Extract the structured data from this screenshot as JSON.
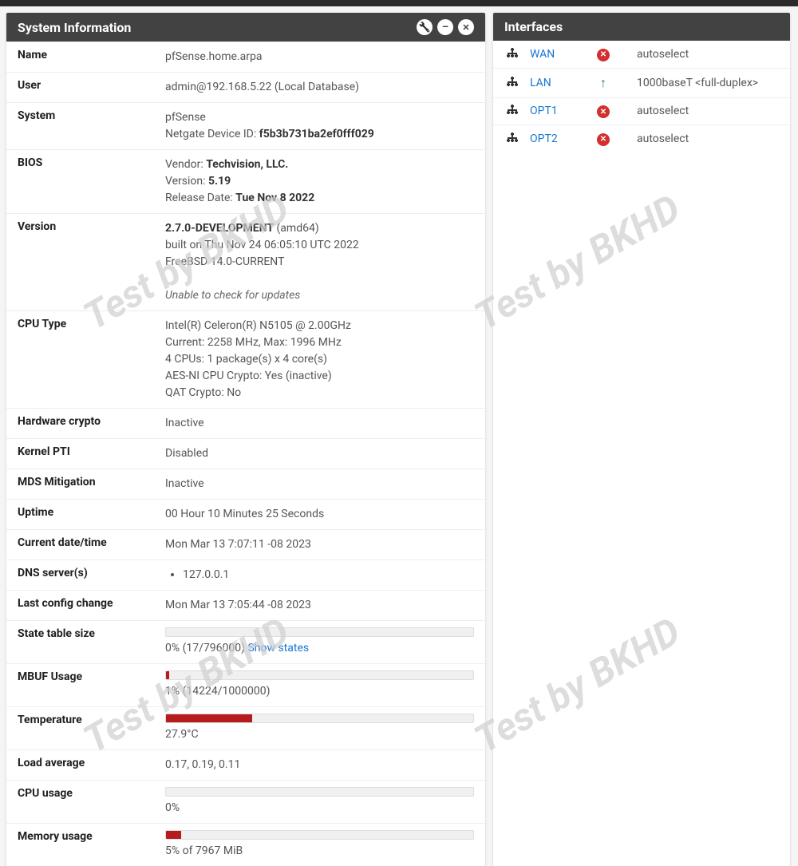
{
  "watermark_text": "Test by BKHD",
  "sysinfo": {
    "title": "System Information",
    "rows": {
      "name_label": "Name",
      "name_value": "pfSense.home.arpa",
      "user_label": "User",
      "user_value": "admin@192.168.5.22 (Local Database)",
      "system_label": "System",
      "system_line1": "pfSense",
      "system_line2_prefix": "Netgate Device ID: ",
      "system_line2_bold": "f5b3b731ba2ef0fff029",
      "bios_label": "BIOS",
      "bios_l1_prefix": "Vendor: ",
      "bios_l1_bold": "Techvision, LLC.",
      "bios_l2_prefix": "Version: ",
      "bios_l2_bold": "5.19",
      "bios_l3_prefix": "Release Date: ",
      "bios_l3_bold": "Tue Nov 8 2022",
      "version_label": "Version",
      "version_l1_bold": "2.7.0-DEVELOPMENT",
      "version_l1_rest": " (amd64)",
      "version_l2": "built on Thu Nov 24 06:05:10 UTC 2022",
      "version_l3": "FreeBSD 14.0-CURRENT",
      "version_update": "Unable to check for updates",
      "cpu_label": "CPU Type",
      "cpu_l1": "Intel(R) Celeron(R) N5105 @ 2.00GHz",
      "cpu_l2": "Current: 2258 MHz, Max: 1996 MHz",
      "cpu_l3": "4 CPUs: 1 package(s) x 4 core(s)",
      "cpu_l4": "AES-NI CPU Crypto: Yes (inactive)",
      "cpu_l5": "QAT Crypto: No",
      "hwcrypto_label": "Hardware crypto",
      "hwcrypto_value": "Inactive",
      "pti_label": "Kernel PTI",
      "pti_value": "Disabled",
      "mds_label": "MDS Mitigation",
      "mds_value": "Inactive",
      "uptime_label": "Uptime",
      "uptime_value": "00 Hour 10 Minutes 25 Seconds",
      "datetime_label": "Current date/time",
      "datetime_value": "Mon Mar 13 7:07:11 -08 2023",
      "dns_label": "DNS server(s)",
      "dns_value": "127.0.0.1",
      "lastcfg_label": "Last config change",
      "lastcfg_value": "Mon Mar 13 7:05:44 -08 2023",
      "state_label": "State table size",
      "state_text": "0% (17/796000) ",
      "state_link": "Show states",
      "mbuf_label": "MBUF Usage",
      "mbuf_text": "1% (14224/1000000)",
      "temp_label": "Temperature",
      "temp_text": "27.9°C",
      "load_label": "Load average",
      "load_value": "0.17, 0.19, 0.11",
      "cpuusage_label": "CPU usage",
      "cpuusage_text": "0%",
      "mem_label": "Memory usage",
      "mem_text": "5% of 7967 MiB"
    },
    "bars": {
      "state_pct": 0,
      "mbuf_pct": 1,
      "temp_pct": 28,
      "cpu_pct": 0,
      "mem_pct": 5
    }
  },
  "interfaces": {
    "title": "Interfaces",
    "items": [
      {
        "name": "WAN",
        "status": "down",
        "speed": "autoselect"
      },
      {
        "name": "LAN",
        "status": "up",
        "speed": "1000baseT <full-duplex>"
      },
      {
        "name": "OPT1",
        "status": "down",
        "speed": "autoselect"
      },
      {
        "name": "OPT2",
        "status": "down",
        "speed": "autoselect"
      }
    ]
  }
}
